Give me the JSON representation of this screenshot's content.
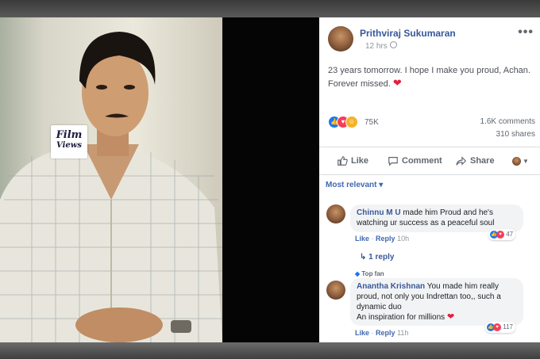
{
  "watermark": {
    "line1": "Film",
    "line2": "Views"
  },
  "post": {
    "author": "Prithviraj Sukumaran",
    "time": "12 hrs",
    "dot": "·",
    "more": "•••",
    "text": "23 years tomorrow. I hope I make you proud, Achan. Forever missed.",
    "heart": "❤",
    "reactions_count": "75K",
    "comments_count": "1.6K comments",
    "shares_count": "310 shares"
  },
  "actions": {
    "like": "Like",
    "comment": "Comment",
    "share": "Share"
  },
  "sort": {
    "label": "Most relevant",
    "caret": "▾"
  },
  "comments": [
    {
      "author": "Chinnu M U",
      "text": "made him Proud and he's watching ur success as a peaceful soul",
      "like": "Like",
      "reply": "Reply",
      "sep": "·",
      "time": "10h",
      "reaction_count": "47"
    },
    {
      "badge": "Top fan",
      "author": "Anantha Krishnan",
      "text": "You made him really proud, not only you Indrettan too,, such a dynamic duo",
      "text2": "An inspiration for millions",
      "heart": "❤",
      "like": "Like",
      "reply": "Reply",
      "sep": "·",
      "time": "11h",
      "reaction_count": "117"
    }
  ],
  "replies": {
    "arrow": "↳",
    "label": "1 reply"
  },
  "colors": {
    "link": "#365899",
    "accent": "#4267b2",
    "heart": "#e41e3f",
    "like_blue": "#1877f2",
    "love_red": "#f33e58",
    "haha_yellow": "#f7b125"
  }
}
